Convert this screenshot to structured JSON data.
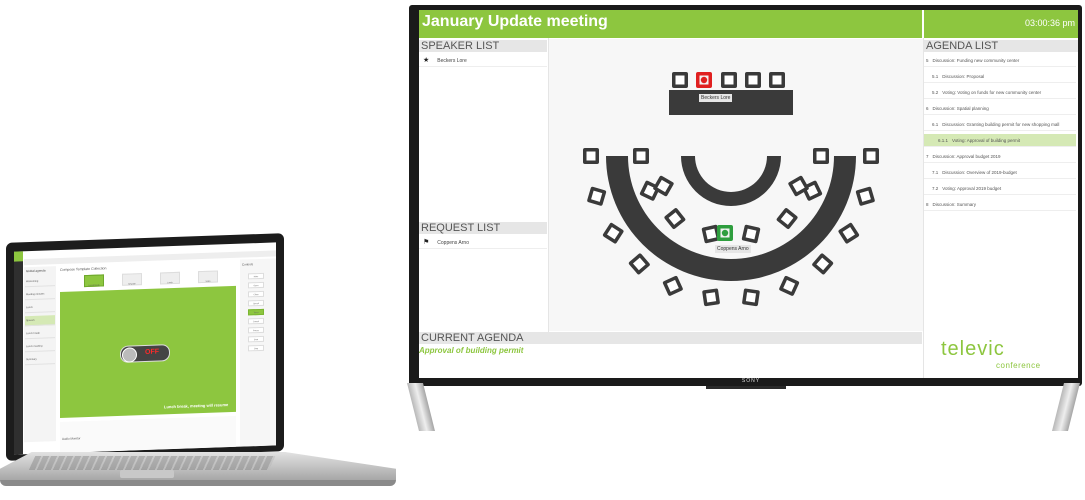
{
  "tv": {
    "brand": "SONY",
    "header": {
      "title": "January Update meeting",
      "time": "03:00:36 pm"
    },
    "speaker_list": {
      "title": "SPEAKER LIST",
      "items": [
        {
          "icon": "star-icon",
          "name": "Beckers Lore"
        }
      ]
    },
    "request_list": {
      "title": "REQUEST LIST",
      "items": [
        {
          "icon": "flag-icon",
          "name": "Coppens Arno"
        }
      ]
    },
    "seatmap": {
      "speaking_label": "Beckers Lore",
      "requesting_label": "Coppens Arno"
    },
    "agenda": {
      "title": "AGENDA LIST",
      "items": [
        {
          "num": "5",
          "text": "Discussion:  Funding new community center"
        },
        {
          "num": "5.1",
          "text": "Discussion:  Proposal"
        },
        {
          "num": "5.2",
          "text": "Voting:  Voting on funds for new community center"
        },
        {
          "num": "6",
          "text": "Discussion:  Spatial planning"
        },
        {
          "num": "6.1",
          "text": "Discussion:  Granting building permit for new shopping mall"
        },
        {
          "num": "6.1.1",
          "text": "Voting:  Approval of building permit",
          "active": true
        },
        {
          "num": "7",
          "text": "Discussion:  Approval budget 2019"
        },
        {
          "num": "7.1",
          "text": "Discussion:  Overview of 2019-budget"
        },
        {
          "num": "7.2",
          "text": "Voting:  Approval 2019 budget"
        },
        {
          "num": "8",
          "text": "Discussion:  Summary"
        }
      ]
    },
    "current_agenda": {
      "title": "CURRENT AGENDA",
      "value": "Approval of building permit"
    },
    "logo": {
      "main": "televic",
      "sub": "conference"
    },
    "colors": {
      "accent": "#8dc63f",
      "speaking": "#e02020",
      "requesting": "#2e9e3e"
    }
  },
  "laptop": {
    "sidebar_title": "Global agenda",
    "nav_items": [
      "Welcoming",
      "Meeting minutes",
      "Lunch",
      "Speech",
      "Lunch break",
      "Lunch meeting",
      "Summary"
    ],
    "active_nav_index": 3,
    "page_header": "Compose Template Collection",
    "tabs": [
      "Lunch break",
      "Keynote",
      "Lunch",
      "Votes"
    ],
    "switch_label": "OFF",
    "message": "Lunch break, meeting will resume",
    "bottom_label": "Audio Monitor",
    "right_panel": {
      "title": "Controls",
      "buttons": [
        "Mute",
        "Open",
        "Close",
        "Speak",
        "Timer",
        "Cancel",
        "Pause",
        "Start",
        "Stop"
      ]
    }
  }
}
